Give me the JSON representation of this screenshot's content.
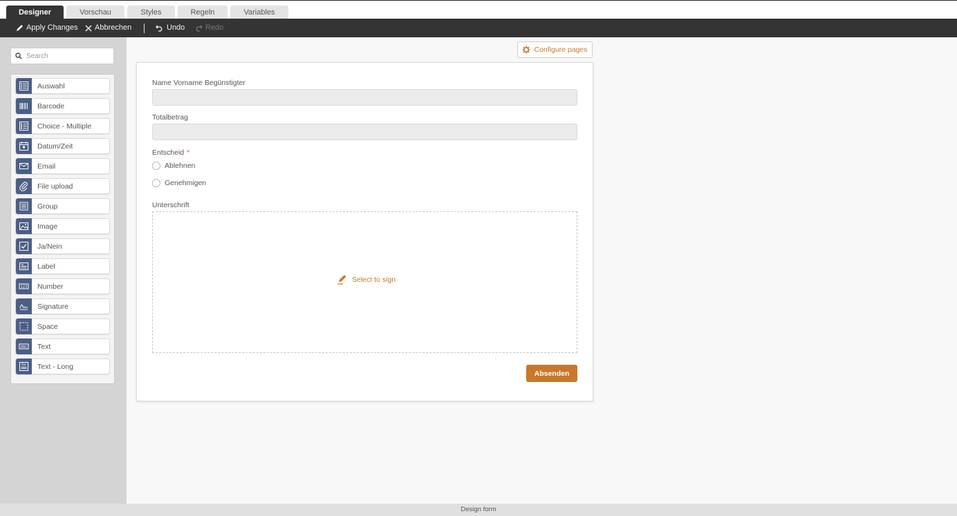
{
  "tabs": [
    {
      "label": "Designer",
      "active": true
    },
    {
      "label": "Vorschau",
      "active": false
    },
    {
      "label": "Styles",
      "active": false
    },
    {
      "label": "Regeln",
      "active": false
    },
    {
      "label": "Variables",
      "active": false
    }
  ],
  "toolbar": {
    "apply_label": "Apply Changes",
    "cancel_label": "Abbrechen",
    "undo_label": "Undo",
    "redo_label": "Redo"
  },
  "sidebar": {
    "search_placeholder": "Search",
    "items": [
      {
        "label": "Auswahl",
        "icon": "list-icon"
      },
      {
        "label": "Barcode",
        "icon": "barcode-icon"
      },
      {
        "label": "Choice - Multiple",
        "icon": "checklist-icon"
      },
      {
        "label": "Datum/Zeit",
        "icon": "calendar-icon"
      },
      {
        "label": "Email",
        "icon": "envelope-icon"
      },
      {
        "label": "File upload",
        "icon": "paperclip-icon"
      },
      {
        "label": "Group",
        "icon": "group-icon"
      },
      {
        "label": "Image",
        "icon": "image-icon"
      },
      {
        "label": "Ja/Nein",
        "icon": "checkbox-icon"
      },
      {
        "label": "Label",
        "icon": "label-icon"
      },
      {
        "label": "Number",
        "icon": "number-icon"
      },
      {
        "label": "Signature",
        "icon": "signature-icon"
      },
      {
        "label": "Space",
        "icon": "space-icon"
      },
      {
        "label": "Text",
        "icon": "text-icon"
      },
      {
        "label": "Text - Long",
        "icon": "text-long-icon"
      }
    ]
  },
  "canvas": {
    "configure_label": "Configure pages",
    "form": {
      "field_name_label": "Name Vorname Begünstigter",
      "field_total_label": "Totalbetrag",
      "decision_label": "Entscheid",
      "required_mark": "*",
      "options": [
        "Ablehnen",
        "Genehmigen"
      ],
      "signature_label": "Unterschrift",
      "signature_action": "Select to sign",
      "submit_label": "Absenden"
    }
  },
  "footer": {
    "text": "Design form"
  },
  "colors": {
    "accent": "#c8782a",
    "toolbar": "#343434",
    "icon_bg": "#4d5e85"
  }
}
